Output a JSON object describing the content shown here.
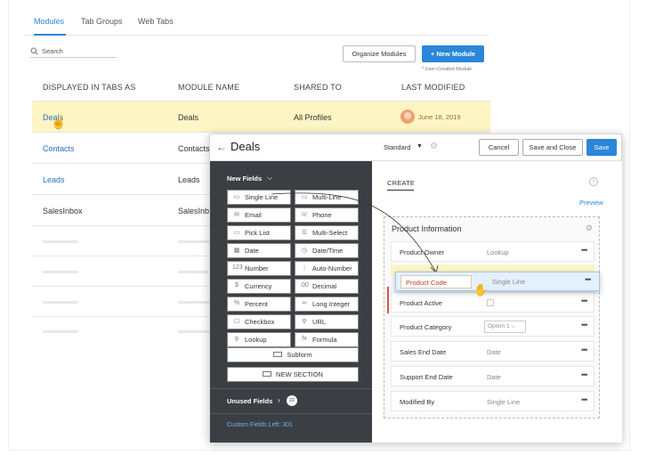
{
  "tabs": [
    "Modules",
    "Tab Groups",
    "Web Tabs"
  ],
  "search": {
    "placeholder": "Search"
  },
  "toolbar": {
    "organize": "Organize Modules",
    "new_module": "+ New Module",
    "user_created": "* User-Created Module"
  },
  "table": {
    "headers": [
      "DISPLAYED IN TABS AS",
      "MODULE NAME",
      "SHARED TO",
      "LAST MODIFIED"
    ],
    "rows": [
      {
        "display": "Deals",
        "module": "Deals",
        "shared": "All Profiles",
        "modified": "June 18, 2019"
      },
      {
        "display": "Contacts",
        "module": "Contacts",
        "shared": "",
        "modified": ""
      },
      {
        "display": "Leads",
        "module": "Leads",
        "shared": "",
        "modified": ""
      },
      {
        "display": "SalesInbox",
        "module": "SalesInb",
        "shared": "",
        "modified": ""
      }
    ]
  },
  "editor": {
    "title": "Deals",
    "layout": "Standard",
    "cancel": "Cancel",
    "save_close": "Save and Close",
    "save": "Save",
    "new_fields": "New Fields",
    "fields": [
      {
        "label": "Single Line",
        "icon": "▭"
      },
      {
        "label": "Multi-Line",
        "icon": "▭"
      },
      {
        "label": "Email",
        "icon": "✉"
      },
      {
        "label": "Phone",
        "icon": "☏"
      },
      {
        "label": "Pick List",
        "icon": "▭"
      },
      {
        "label": "Multi-Select",
        "icon": "☰"
      },
      {
        "label": "Date",
        "icon": "▦"
      },
      {
        "label": "Date/Time",
        "icon": "◷"
      },
      {
        "label": "Number",
        "icon": "123"
      },
      {
        "label": "Auto-Number",
        "icon": "⋮"
      },
      {
        "label": "Currency",
        "icon": "$"
      },
      {
        "label": "Decimal",
        "icon": ".00"
      },
      {
        "label": "Percent",
        "icon": "%"
      },
      {
        "label": "Long Integer",
        "icon": "∞"
      },
      {
        "label": "Checkbox",
        "icon": "☐"
      },
      {
        "label": "URL",
        "icon": "⚲"
      },
      {
        "label": "Lookup",
        "icon": "⚲"
      },
      {
        "label": "Formula",
        "icon": "fx"
      }
    ],
    "subform": "Subform",
    "new_section": "NEW SECTION",
    "unused_fields": "Unused Fields",
    "unused_count": "22",
    "custom_left": "Custom Fields Left: 301",
    "create_tab": "CREATE",
    "preview": "Preview",
    "section_title": "Product Information",
    "section_fields": [
      {
        "name": "Product Owner",
        "type": "Lookup"
      },
      {
        "name": "Product Active",
        "type": ""
      },
      {
        "name": "Product Category",
        "type": "Option 1"
      },
      {
        "name": "Sales End Date",
        "type": "Date"
      },
      {
        "name": "Support End Date",
        "type": "Date"
      },
      {
        "name": "Modified By",
        "type": "Single Line"
      }
    ],
    "dragged": {
      "name": "Product Code",
      "type": "Single Line"
    }
  }
}
